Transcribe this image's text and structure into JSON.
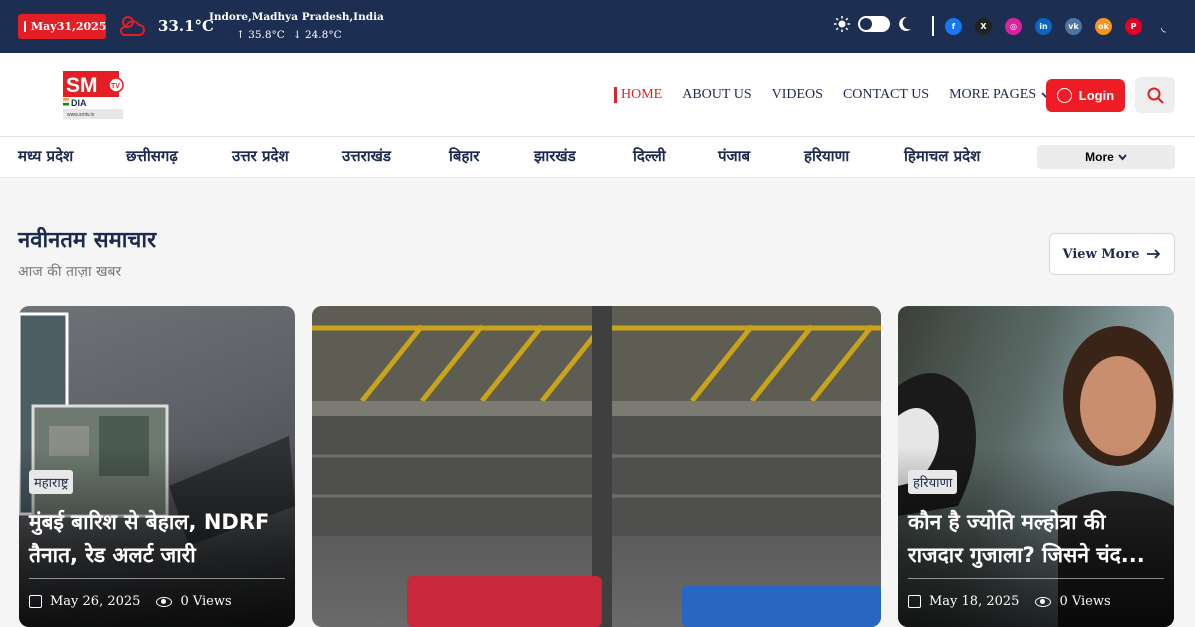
{
  "topbar": {
    "date": "May31,2025",
    "temperature": "33.1°C",
    "location": "Indore,Madhya Pradesh,India",
    "high": "↑ 35.8°C",
    "low": "↓ 24.8°C",
    "socials": [
      {
        "icon": "facebook-icon",
        "glyph": "f",
        "color": "#1877f2"
      },
      {
        "icon": "x-icon",
        "glyph": "X",
        "color": "#222222"
      },
      {
        "icon": "instagram-icon",
        "glyph": "◎",
        "color": "#d6249f"
      },
      {
        "icon": "linkedin-icon",
        "glyph": "in",
        "color": "#0a66c2"
      },
      {
        "icon": "vk-icon",
        "glyph": "vk",
        "color": "#4c75a3"
      },
      {
        "icon": "odnoklassniki-icon",
        "glyph": "ok",
        "color": "#f7931e"
      },
      {
        "icon": "pinterest-icon",
        "glyph": "P",
        "color": "#e60023"
      },
      {
        "icon": "rss-icon",
        "glyph": "◟",
        "color": "#1c2e52"
      }
    ]
  },
  "header": {
    "logo_text": "SM",
    "logo_tv": "TV",
    "logo_sub": "DIA",
    "logo_url_text": "www.smtv.in",
    "nav": [
      "HOME",
      "ABOUT US",
      "VIDEOS",
      "CONTACT US",
      "MORE PAGES"
    ],
    "login_label": "Login"
  },
  "categories": [
    "मध्य प्रदेश",
    "छत्तीसगढ़",
    "उत्तर प्रदेश",
    "उत्तराखंड",
    "बिहार",
    "झारखंड",
    "दिल्ली",
    "पंजाब",
    "हरियाणा",
    "हिमाचल प्रदेश"
  ],
  "more_label": "More",
  "section": {
    "title": "नवीनतम समाचार",
    "subtitle": "आज की ताज़ा खबर",
    "view_more": "View More"
  },
  "cards": [
    {
      "tag": "महाराष्ट्र",
      "headline": "मुंबई बारिश से बेहाल, NDRF तैनात, रेड अलर्ट जारी",
      "date": "May 26, 2025",
      "views": "0 Views"
    },
    {
      "tag": "",
      "headline": "",
      "date": "",
      "views": ""
    },
    {
      "tag": "हरियाणा",
      "headline": "कौन है ज्योति मल्होत्रा की राजदार गुजाला? जिसने चंद...",
      "date": "May 18, 2025",
      "views": "0 Views"
    }
  ],
  "colors": {
    "brand_red": "#e31e24",
    "navy": "#1c2e52"
  }
}
